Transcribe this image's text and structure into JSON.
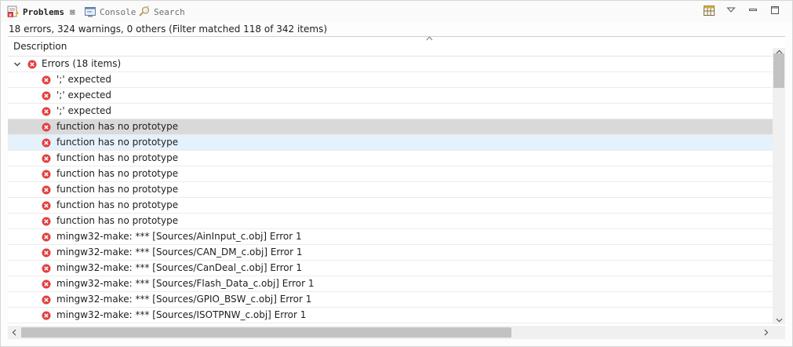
{
  "tabs": [
    {
      "label": "Problems",
      "icon": "problems-icon",
      "active": true,
      "closable": true
    },
    {
      "label": "Console",
      "icon": "console-icon",
      "active": false
    },
    {
      "label": "Search",
      "icon": "search-icon",
      "active": false
    }
  ],
  "view_toolbar": [
    "table-view-icon",
    "view-menu-icon",
    "minimize-icon",
    "maximize-icon"
  ],
  "summary": "18 errors, 324 warnings, 0 others (Filter matched 118 of 342 items)",
  "table": {
    "column_header": "Description",
    "group": {
      "label": "Errors (18 items)",
      "expanded": true
    },
    "rows": [
      "';' expected",
      "';' expected",
      "';' expected",
      "function has no prototype",
      "function has no prototype",
      "function has no prototype",
      "function has no prototype",
      "function has no prototype",
      "function has no prototype",
      "function has no prototype",
      "mingw32-make: *** [Sources/AinInput_c.obj] Error 1",
      "mingw32-make: *** [Sources/CAN_DM_c.obj] Error 1",
      "mingw32-make: *** [Sources/CanDeal_c.obj] Error 1",
      "mingw32-make: *** [Sources/Flash_Data_c.obj] Error 1",
      "mingw32-make: *** [Sources/GPIO_BSW_c.obj] Error 1",
      "mingw32-make: *** [Sources/ISOTPNW_c.obj] Error 1"
    ],
    "selected_row_index": 3,
    "hovered_row_index": 4
  },
  "colors": {
    "error_red": "#e0403f",
    "selection_gray": "#d9d9d9",
    "hover_blue": "#e5f1fb"
  }
}
